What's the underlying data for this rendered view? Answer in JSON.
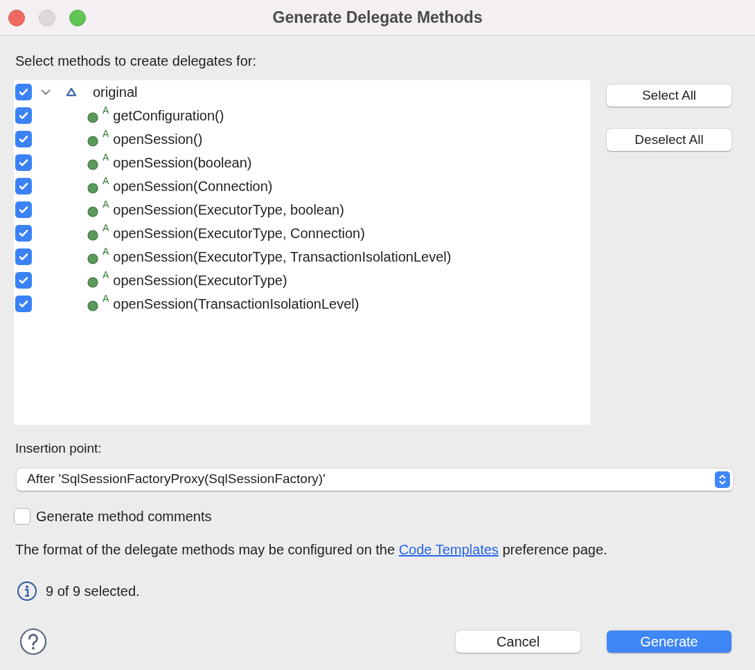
{
  "window": {
    "title": "Generate Delegate Methods"
  },
  "prompt": "Select methods to create delegates for:",
  "tree": [
    {
      "label": "original",
      "checked": true,
      "expanded": true,
      "children": [
        {
          "label": "getConfiguration()",
          "marker": "A",
          "checked": true
        },
        {
          "label": "openSession()",
          "marker": "A",
          "checked": true
        },
        {
          "label": "openSession(boolean)",
          "marker": "A",
          "checked": true
        },
        {
          "label": "openSession(Connection)",
          "marker": "A",
          "checked": true
        },
        {
          "label": "openSession(ExecutorType, boolean)",
          "marker": "A",
          "checked": true
        },
        {
          "label": "openSession(ExecutorType, Connection)",
          "marker": "A",
          "checked": true
        },
        {
          "label": "openSession(ExecutorType, TransactionIsolationLevel)",
          "marker": "A",
          "checked": true
        },
        {
          "label": "openSession(ExecutorType)",
          "marker": "A",
          "checked": true
        },
        {
          "label": "openSession(TransactionIsolationLevel)",
          "marker": "A",
          "checked": true
        }
      ]
    }
  ],
  "side_buttons": [
    "Select All",
    "Deselect All"
  ],
  "insertion": {
    "label": "Insertion point:",
    "value": "After 'SqlSessionFactoryProxy(SqlSessionFactory)'"
  },
  "comments": {
    "label": "Generate method comments",
    "checked": false
  },
  "note": {
    "before": "The format of the delegate methods may be configured on the ",
    "link": "Code Templates",
    "after": " preference page."
  },
  "status": "9 of 9 selected.",
  "buttons": [
    {
      "label": "Cancel",
      "kind": "secondary"
    },
    {
      "label": "Generate",
      "kind": "primary"
    }
  ]
}
